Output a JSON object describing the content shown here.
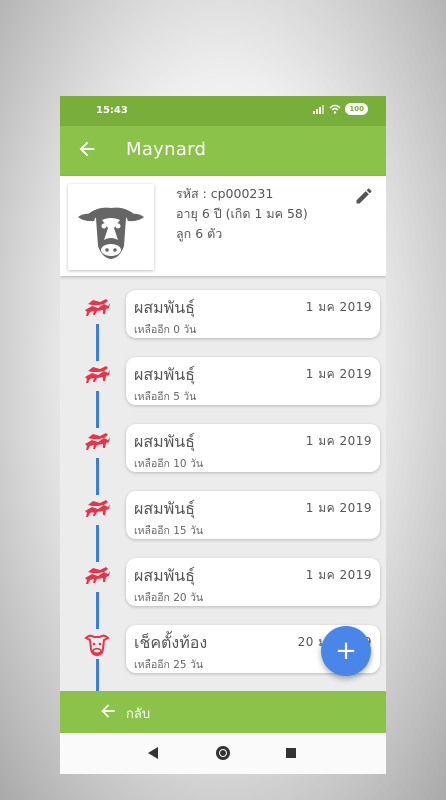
{
  "status_bar": {
    "time": "15:43",
    "battery": "100"
  },
  "app_bar": {
    "title": "Maynard"
  },
  "profile": {
    "code": "รหัส : cp000231",
    "age": "อายุ 6 ปี (เกิด 1 มค 58)",
    "children": "ลูก 6 ตัว"
  },
  "timeline": [
    {
      "event": "ผสมพันธุ์",
      "date": "1 มค  2019",
      "remaining": "เหลืออีก 0 วัน",
      "icon": "breeding-icon"
    },
    {
      "event": "ผสมพันธุ์",
      "date": "1 มค  2019",
      "remaining": "เหลืออีก 5 วัน",
      "icon": "breeding-icon"
    },
    {
      "event": "ผสมพันธุ์",
      "date": "1 มค  2019",
      "remaining": "เหลืออีก 10 วัน",
      "icon": "breeding-icon"
    },
    {
      "event": "ผสมพันธุ์",
      "date": "1 มค  2019",
      "remaining": "เหลืออีก 15 วัน",
      "icon": "breeding-icon"
    },
    {
      "event": "ผสมพันธุ์",
      "date": "1 มค  2019",
      "remaining": "เหลืออีก 20 วัน",
      "icon": "breeding-icon"
    },
    {
      "event": "เช็คตั้งท้อง",
      "date": "20 มค 2019",
      "remaining": "เหลืออีก 25 วัน",
      "icon": "cow-head-icon"
    }
  ],
  "fab": {
    "label": "+"
  },
  "bottom_bar": {
    "label": "กลับ"
  },
  "colors": {
    "primary": "#8bc34a",
    "status": "#79ae3a",
    "timeline": "#3b7dd8",
    "event_icon": "#e8334a",
    "fab": "#4a86e8"
  }
}
